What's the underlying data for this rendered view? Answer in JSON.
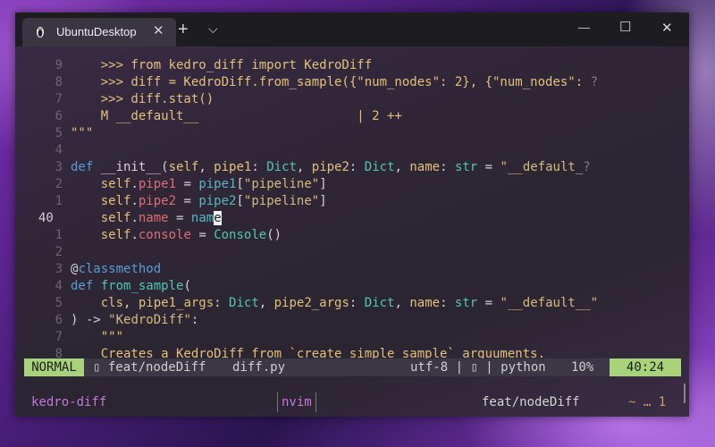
{
  "window": {
    "tab_title": "UbuntuDesktop",
    "tab_close": "✕",
    "new_tab": "+",
    "dropdown": "⌵",
    "minimize": "—",
    "maximize": "☐",
    "close": "✕"
  },
  "editor": {
    "line_numbers": [
      "9",
      "8",
      "7",
      "6",
      "5",
      "4",
      "3",
      "2",
      "1",
      "40",
      "1",
      "2",
      "3",
      "4",
      "5",
      "6",
      "7",
      "8"
    ],
    "lines": [
      [
        {
          "t": "    >>> from kedro_diff import KedroDiff",
          "c": "yl"
        }
      ],
      [
        {
          "t": "    >>> diff = KedroDiff.from_sample({\"num_nodes\": 2}, {\"num_nodes\": ",
          "c": "yl"
        },
        {
          "t": "?",
          "c": "gr"
        }
      ],
      [
        {
          "t": "    >>> diff.stat()",
          "c": "yl"
        }
      ],
      [
        {
          "t": "    M __default__                     | 2 ++",
          "c": "yl"
        }
      ],
      [
        {
          "t": "\"\"\"",
          "c": "yl"
        }
      ],
      [],
      [
        {
          "t": "def ",
          "c": "kw"
        },
        {
          "t": "__init__",
          "c": "wh"
        },
        {
          "t": "(",
          "c": "wh"
        },
        {
          "t": "self",
          "c": "yl"
        },
        {
          "t": ", ",
          "c": "wh"
        },
        {
          "t": "pipe1",
          "c": "yl"
        },
        {
          "t": ": ",
          "c": "wh"
        },
        {
          "t": "Dict",
          "c": "fn"
        },
        {
          "t": ", ",
          "c": "wh"
        },
        {
          "t": "pipe2",
          "c": "yl"
        },
        {
          "t": ": ",
          "c": "wh"
        },
        {
          "t": "Dict",
          "c": "fn"
        },
        {
          "t": ", ",
          "c": "wh"
        },
        {
          "t": "name",
          "c": "yl"
        },
        {
          "t": ": ",
          "c": "wh"
        },
        {
          "t": "str",
          "c": "fn"
        },
        {
          "t": " = ",
          "c": "wh"
        },
        {
          "t": "\"__default_",
          "c": "st"
        },
        {
          "t": "?",
          "c": "gr"
        }
      ],
      [
        {
          "t": "    self",
          "c": "yl"
        },
        {
          "t": ".",
          "c": "wh"
        },
        {
          "t": "pipe1",
          "c": "rd"
        },
        {
          "t": " = ",
          "c": "wh"
        },
        {
          "t": "pipe1",
          "c": "cy"
        },
        {
          "t": "[",
          "c": "wh"
        },
        {
          "t": "\"pipeline\"",
          "c": "st"
        },
        {
          "t": "]",
          "c": "wh"
        }
      ],
      [
        {
          "t": "    self",
          "c": "yl"
        },
        {
          "t": ".",
          "c": "wh"
        },
        {
          "t": "pipe2",
          "c": "rd"
        },
        {
          "t": " = ",
          "c": "wh"
        },
        {
          "t": "pipe2",
          "c": "cy"
        },
        {
          "t": "[",
          "c": "wh"
        },
        {
          "t": "\"pipeline\"",
          "c": "st"
        },
        {
          "t": "]",
          "c": "wh"
        }
      ],
      [
        {
          "t": "    self",
          "c": "yl"
        },
        {
          "t": ".",
          "c": "wh"
        },
        {
          "t": "name",
          "c": "rd"
        },
        {
          "t": " = ",
          "c": "wh"
        },
        {
          "t": "nam",
          "c": "cy"
        },
        {
          "t": "e",
          "c": "cursor"
        }
      ],
      [
        {
          "t": "    self",
          "c": "yl"
        },
        {
          "t": ".",
          "c": "wh"
        },
        {
          "t": "console",
          "c": "rd"
        },
        {
          "t": " = ",
          "c": "wh"
        },
        {
          "t": "Console",
          "c": "fn"
        },
        {
          "t": "()",
          "c": "wh"
        }
      ],
      [],
      [
        {
          "t": "@",
          "c": "wh"
        },
        {
          "t": "classmethod",
          "c": "kw"
        }
      ],
      [
        {
          "t": "def ",
          "c": "kw"
        },
        {
          "t": "from_sample",
          "c": "fn"
        },
        {
          "t": "(",
          "c": "wh"
        }
      ],
      [
        {
          "t": "    cls",
          "c": "yl"
        },
        {
          "t": ", ",
          "c": "wh"
        },
        {
          "t": "pipe1_args",
          "c": "yl"
        },
        {
          "t": ": ",
          "c": "wh"
        },
        {
          "t": "Dict",
          "c": "fn"
        },
        {
          "t": ", ",
          "c": "wh"
        },
        {
          "t": "pipe2_args",
          "c": "yl"
        },
        {
          "t": ": ",
          "c": "wh"
        },
        {
          "t": "Dict",
          "c": "fn"
        },
        {
          "t": ", ",
          "c": "wh"
        },
        {
          "t": "name",
          "c": "yl"
        },
        {
          "t": ": ",
          "c": "wh"
        },
        {
          "t": "str",
          "c": "fn"
        },
        {
          "t": " = ",
          "c": "wh"
        },
        {
          "t": "\"__default__\"",
          "c": "st"
        }
      ],
      [
        {
          "t": ") -> ",
          "c": "wh"
        },
        {
          "t": "\"KedroDiff\"",
          "c": "st"
        },
        {
          "t": ":",
          "c": "wh"
        }
      ],
      [
        {
          "t": "    \"\"\"",
          "c": "yl"
        }
      ],
      [
        {
          "t": "    Creates a KedroDiff from `create_simple_sample` arguuments.",
          "c": "yl"
        }
      ]
    ]
  },
  "statusline": {
    "mode": "NORMAL",
    "branch": "▯ feat/nodeDiff",
    "file": "diff.py",
    "encoding": "utf-8 | ▯ | python",
    "percent": "10%",
    "position": "40:24"
  },
  "tmux": {
    "session": "kedro-diff",
    "window": "nvim",
    "git_branch": " feat/nodeDiff",
    "git_status": "~ … 1"
  }
}
